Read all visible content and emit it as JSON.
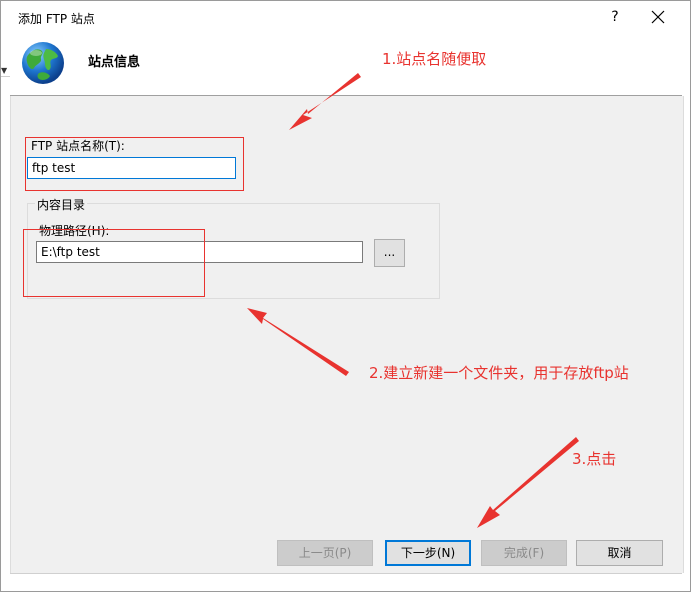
{
  "window": {
    "title": "添加 FTP 站点",
    "help_label": "?",
    "close_label": "✕"
  },
  "header": {
    "title": "站点信息",
    "icon": "globe-icon"
  },
  "form": {
    "site_name_label": "FTP 站点名称(T):",
    "site_name_value": "ftp test",
    "content_dir_label": "内容目录",
    "physical_path_label": "物理路径(H):",
    "physical_path_value": "E:\\ftp test",
    "browse_label": "..."
  },
  "buttons": {
    "prev_label": "上一页(P)",
    "next_label": "下一步(N)",
    "finish_label": "完成(F)",
    "cancel_label": "取消"
  },
  "annotations": {
    "note1": "1.站点名随便取",
    "note2": "2.建立新建一个文件夹，用于存放ftp站",
    "note3": "3.点击",
    "color": "#e8332f"
  }
}
